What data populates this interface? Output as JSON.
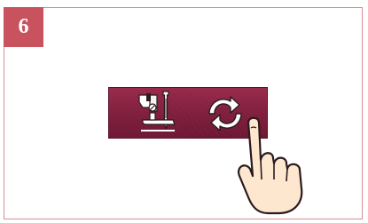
{
  "step": {
    "number": "6"
  },
  "panel": {
    "color": "#8a2142",
    "icons": {
      "presser_foot": "presser-foot-needle-icon",
      "rotate": "rotate-arrows-icon"
    }
  },
  "pointer": {
    "icon": "pointing-hand-icon"
  },
  "colors": {
    "badge": "#c8535e",
    "frame_border": "#d98b93"
  }
}
